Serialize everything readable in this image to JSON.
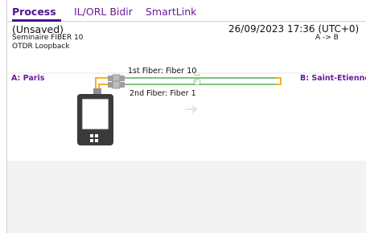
{
  "tabs": [
    {
      "label": "Process",
      "active": true
    },
    {
      "label": "IL/ORL Bidir",
      "active": false
    },
    {
      "label": "SmartLink",
      "active": false
    }
  ],
  "info": {
    "status": "(Unsaved)",
    "name": "Seminaire FIBER 10",
    "mode": "OTDR Loopback",
    "datetime": "26/09/2023 17:36 (UTC+0)",
    "direction": "A -> B"
  },
  "schema": {
    "end_a": "A: Paris",
    "end_b": "B: Saint-Etienne",
    "fiber1_label": "1st Fiber: Fiber 10",
    "fiber2_label": "2nd Fiber: Fiber 1",
    "fiber1_marker": "1",
    "fiber2_marker": "2"
  },
  "colors": {
    "accent": "#4a148c",
    "fiber_green": "#7cc47c",
    "patch_yellow": "#f0b429",
    "device_dark": "#3a3a3a"
  }
}
